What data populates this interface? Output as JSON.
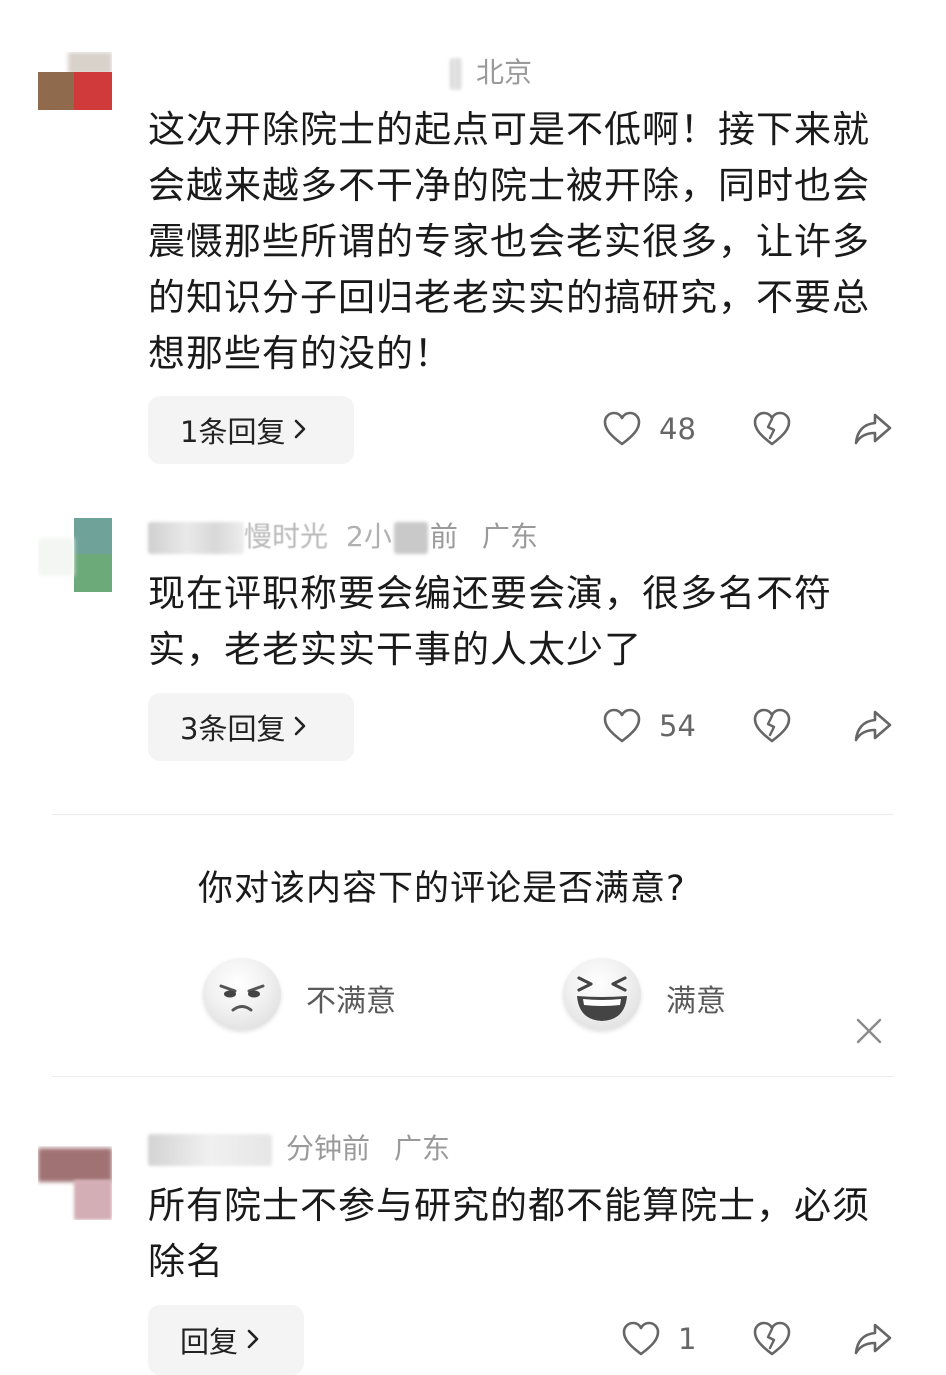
{
  "comments": [
    {
      "location": "北京",
      "text": "这次开除院士的起点可是不低啊！接下来就会越来越多不干净的院士被开除，同时也会震慑那些所谓的专家也会老实很多，让许多的知识分子回归老老实实的搞研究，不要总想那些有的没的！",
      "reply_label": "1条回复",
      "likes": "48"
    },
    {
      "username_visible": "慢时光",
      "time_visible": "2小",
      "time_suffix": "前",
      "location": "广东",
      "text": "现在评职称要会编还要会演，很多名不符实，老老实实干事的人太少了",
      "reply_label": "3条回复",
      "likes": "54"
    },
    {
      "time": "分钟前",
      "location": "广东",
      "text": "所有院士不参与研究的都不能算院士，必须除名",
      "reply_label": "回复",
      "likes": "1"
    }
  ],
  "survey": {
    "question": "你对该内容下的评论是否满意?",
    "options": [
      {
        "label": "不满意"
      },
      {
        "label": "满意"
      }
    ]
  },
  "icons": {
    "like": "heart-outline-icon",
    "dislike": "broken-heart-icon",
    "share": "share-arrow-icon",
    "close": "close-icon",
    "chevron": "chevron-right-icon"
  },
  "colors": {
    "text_primary": "#1a1a1a",
    "text_meta": "#9a9a9a",
    "button_bg": "#f4f4f4",
    "icon_gray": "#666666"
  }
}
